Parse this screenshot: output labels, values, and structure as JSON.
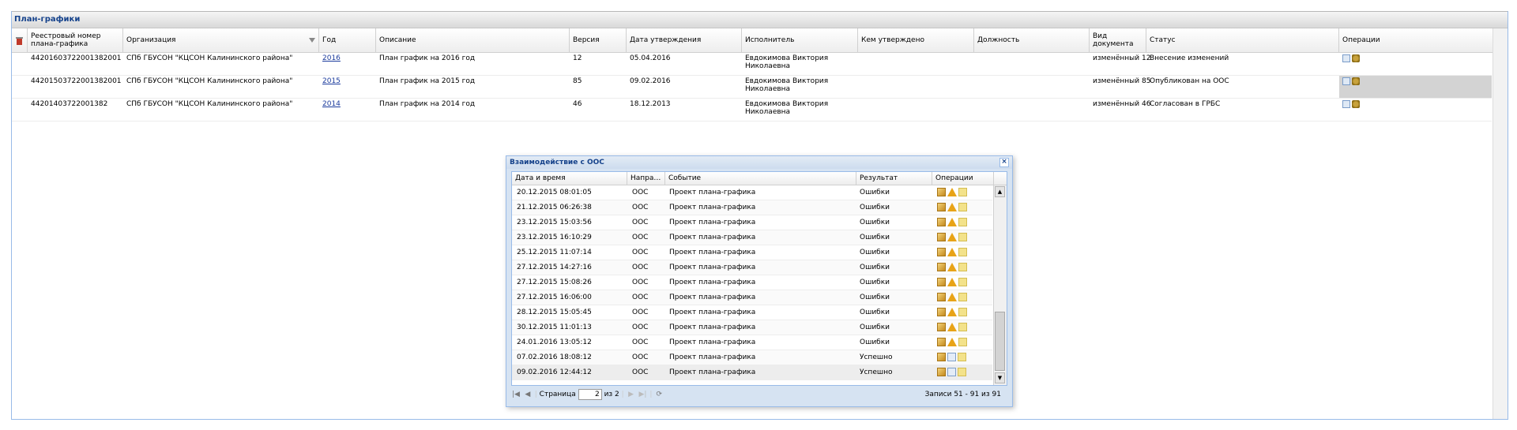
{
  "panel": {
    "title": "План-графики"
  },
  "grid": {
    "columns": [
      {
        "key": "reg",
        "label": "Реестровый номер плана-графика"
      },
      {
        "key": "org",
        "label": "Организация"
      },
      {
        "key": "year",
        "label": "Год"
      },
      {
        "key": "desc",
        "label": "Описание"
      },
      {
        "key": "ver",
        "label": "Версия"
      },
      {
        "key": "date",
        "label": "Дата утверждения"
      },
      {
        "key": "exec",
        "label": "Исполнитель"
      },
      {
        "key": "approved_by",
        "label": "Кем утверждено"
      },
      {
        "key": "position",
        "label": "Должность"
      },
      {
        "key": "doctype",
        "label": "Вид документа"
      },
      {
        "key": "status",
        "label": "Статус"
      },
      {
        "key": "ops",
        "label": "Операции"
      }
    ],
    "rows": [
      {
        "reg": "44201603722001382001",
        "org": "СПб ГБУСОН \"КЦСОН Калининского района\"",
        "year": "2016",
        "desc": "План график на 2016 год",
        "ver": "12",
        "date": "05.04.2016",
        "exec": "Евдокимова Виктория Николаевна",
        "doctype": "изменённый 12",
        "status": "Внесение изменений"
      },
      {
        "reg": "44201503722001382001",
        "org": "СПб ГБУСОН \"КЦСОН Калининского района\"",
        "year": "2015",
        "desc": "План график на 2015 год",
        "ver": "85",
        "date": "09.02.2016",
        "exec": "Евдокимова Виктория Николаевна",
        "doctype": "изменённый 85",
        "status": "Опубликован на ООС"
      },
      {
        "reg": "44201403722001382",
        "org": "СПб ГБУСОН \"КЦСОН Калининского района\"",
        "year": "2014",
        "desc": "План график на 2014 год",
        "ver": "46",
        "date": "18.12.2013",
        "exec": "Евдокимова Виктория Николаевна",
        "doctype": "изменённый 46",
        "status": "Согласован в ГРБС"
      }
    ]
  },
  "dialog": {
    "title": "Взаимодействие с ООС",
    "close_glyph": "×",
    "columns": [
      "Дата и время",
      "Напра…",
      "Событие",
      "Результат",
      "Операции"
    ],
    "rows": [
      {
        "dt": "20.12.2015 08:01:05",
        "dir": "ООС",
        "event": "Проект плана-графика",
        "result": "Ошибки",
        "ok": false
      },
      {
        "dt": "21.12.2015 06:26:38",
        "dir": "ООС",
        "event": "Проект плана-графика",
        "result": "Ошибки",
        "ok": false
      },
      {
        "dt": "23.12.2015 15:03:56",
        "dir": "ООС",
        "event": "Проект плана-графика",
        "result": "Ошибки",
        "ok": false
      },
      {
        "dt": "23.12.2015 16:10:29",
        "dir": "ООС",
        "event": "Проект плана-графика",
        "result": "Ошибки",
        "ok": false
      },
      {
        "dt": "25.12.2015 11:07:14",
        "dir": "ООС",
        "event": "Проект плана-графика",
        "result": "Ошибки",
        "ok": false
      },
      {
        "dt": "27.12.2015 14:27:16",
        "dir": "ООС",
        "event": "Проект плана-графика",
        "result": "Ошибки",
        "ok": false
      },
      {
        "dt": "27.12.2015 15:08:26",
        "dir": "ООС",
        "event": "Проект плана-графика",
        "result": "Ошибки",
        "ok": false
      },
      {
        "dt": "27.12.2015 16:06:00",
        "dir": "ООС",
        "event": "Проект плана-графика",
        "result": "Ошибки",
        "ok": false
      },
      {
        "dt": "28.12.2015 15:05:45",
        "dir": "ООС",
        "event": "Проект плана-графика",
        "result": "Ошибки",
        "ok": false
      },
      {
        "dt": "30.12.2015 11:01:13",
        "dir": "ООС",
        "event": "Проект плана-графика",
        "result": "Ошибки",
        "ok": false
      },
      {
        "dt": "24.01.2016 13:05:12",
        "dir": "ООС",
        "event": "Проект плана-графика",
        "result": "Ошибки",
        "ok": false
      },
      {
        "dt": "07.02.2016 18:08:12",
        "dir": "ООС",
        "event": "Проект плана-графика",
        "result": "Успешно",
        "ok": true
      },
      {
        "dt": "09.02.2016 12:44:12",
        "dir": "ООС",
        "event": "Проект плана-графика",
        "result": "Успешно",
        "ok": true
      }
    ],
    "pager": {
      "page_label": "Страница",
      "page_value": "2",
      "of_label": "из 2",
      "records": "Записи 51 - 91 из 91"
    }
  },
  "colors": {
    "header_text": "#15428b",
    "border": "#99bbe8",
    "dialog_bg": "#d6e3f2",
    "link": "#1a3a9c"
  },
  "icons": {
    "filter_clear": "filter-clear-icon",
    "sort": "sort-desc-icon",
    "doc": "document-icon",
    "emblem": "emblem-icon",
    "package": "package-icon",
    "warning": "warning-icon",
    "success": "success-doc-icon",
    "envelope": "envelope-icon"
  }
}
